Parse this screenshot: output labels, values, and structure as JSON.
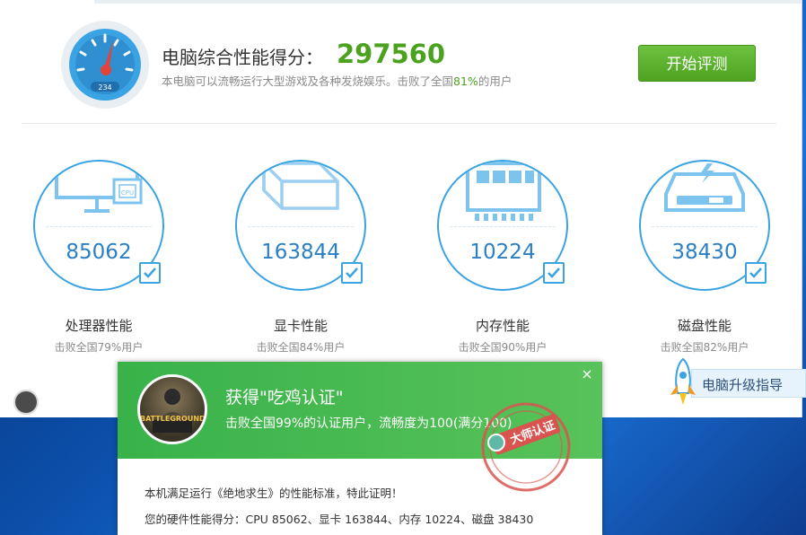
{
  "score": {
    "title": "电脑综合性能得分：",
    "value": "297560",
    "sub_prefix": "本电脑可以流畅运行大型游戏及各种发烧娱乐。击败了全国",
    "sub_pct": "81%",
    "sub_suffix": "的用户",
    "gauge_digits": "234"
  },
  "start_button": "开始评测",
  "cards": [
    {
      "score": "85062",
      "label": "处理器性能",
      "sub": "击败全国79%用户",
      "icon": "cpu-monitor-icon"
    },
    {
      "score": "163844",
      "label": "显卡性能",
      "sub": "击败全国84%用户",
      "icon": "graphics-cube-icon"
    },
    {
      "score": "10224",
      "label": "内存性能",
      "sub": "击败全国90%用户",
      "icon": "memory-chip-icon"
    },
    {
      "score": "38430",
      "label": "磁盘性能",
      "sub": "击败全国82%用户",
      "icon": "disk-drive-icon"
    }
  ],
  "upgrade": {
    "label": "电脑升级指导",
    "icon": "rocket-icon"
  },
  "popup": {
    "title": "获得\"吃鸡认证\"",
    "subtitle": "击败全国99%的认证用户，流畅度为100(满分100)",
    "game_logo": "BATTLEGROUNDS",
    "stamp_text": "大师认证",
    "line1": "本机满足运行《绝地求生》的性能标准，特此证明！",
    "line2": "您的硬件性能得分：CPU 85062、显卡 163844、内存 10224、磁盘 38430",
    "close": "×"
  },
  "colors": {
    "accent_green": "#4aa21e",
    "accent_blue": "#3aa3e3",
    "gauge_red": "#e2433b"
  }
}
